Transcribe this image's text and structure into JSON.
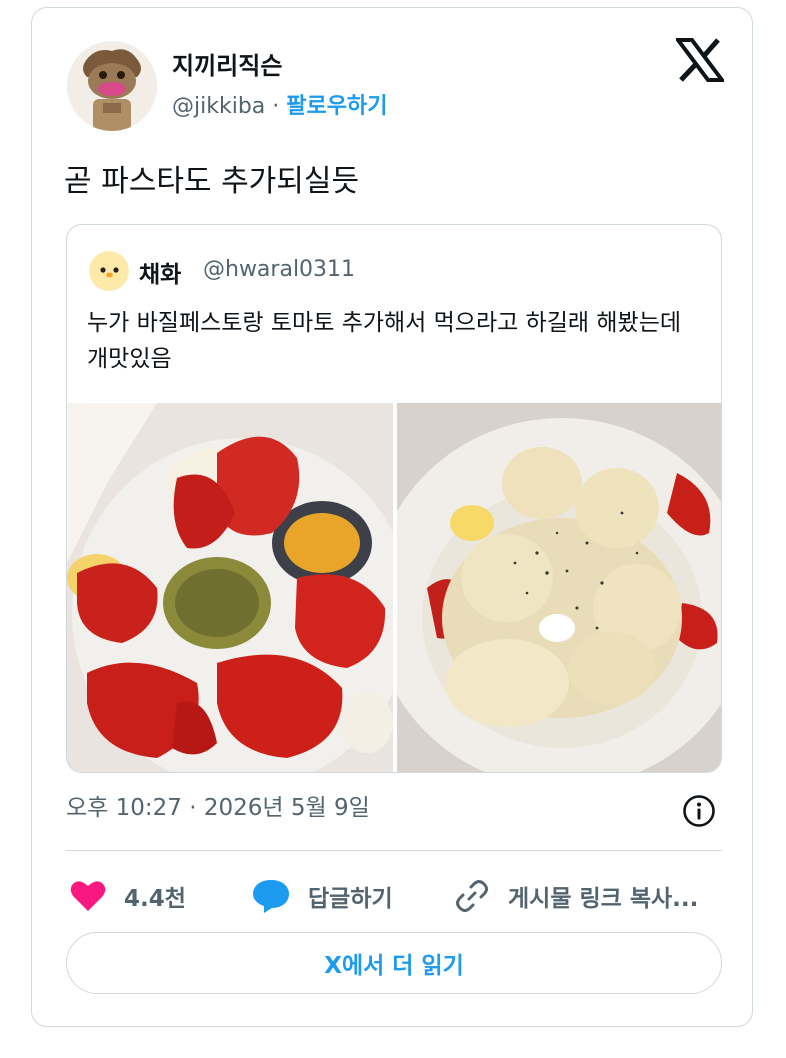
{
  "author": {
    "name": "지끼리직슨",
    "handle": "@jikkiba",
    "separator": "·",
    "follow_label": "팔로우하기"
  },
  "tweet": {
    "text": "곧 파스타도 추가되실듯",
    "timestamp": "오후 10:27 · 2026년 5월 9일"
  },
  "quoted": {
    "name": "채화",
    "handle": "@hwaral0311",
    "text": "누가 바질페스토랑 토마토 추가해서 먹으라고 하길래 해봤는데 개맛있음"
  },
  "actions": {
    "like_count": "4.4천",
    "reply_label": "답글하기",
    "copy_link_label": "게시물 링크 복사..."
  },
  "read_more_label": "X에서 더 읽기",
  "colors": {
    "accent": "#1d9bf0",
    "like": "#f91880",
    "secondary_text": "#536471",
    "border": "#cfd9de"
  },
  "icons": [
    "x-logo-icon",
    "info-icon",
    "heart-icon",
    "reply-bubble-icon",
    "link-icon"
  ]
}
